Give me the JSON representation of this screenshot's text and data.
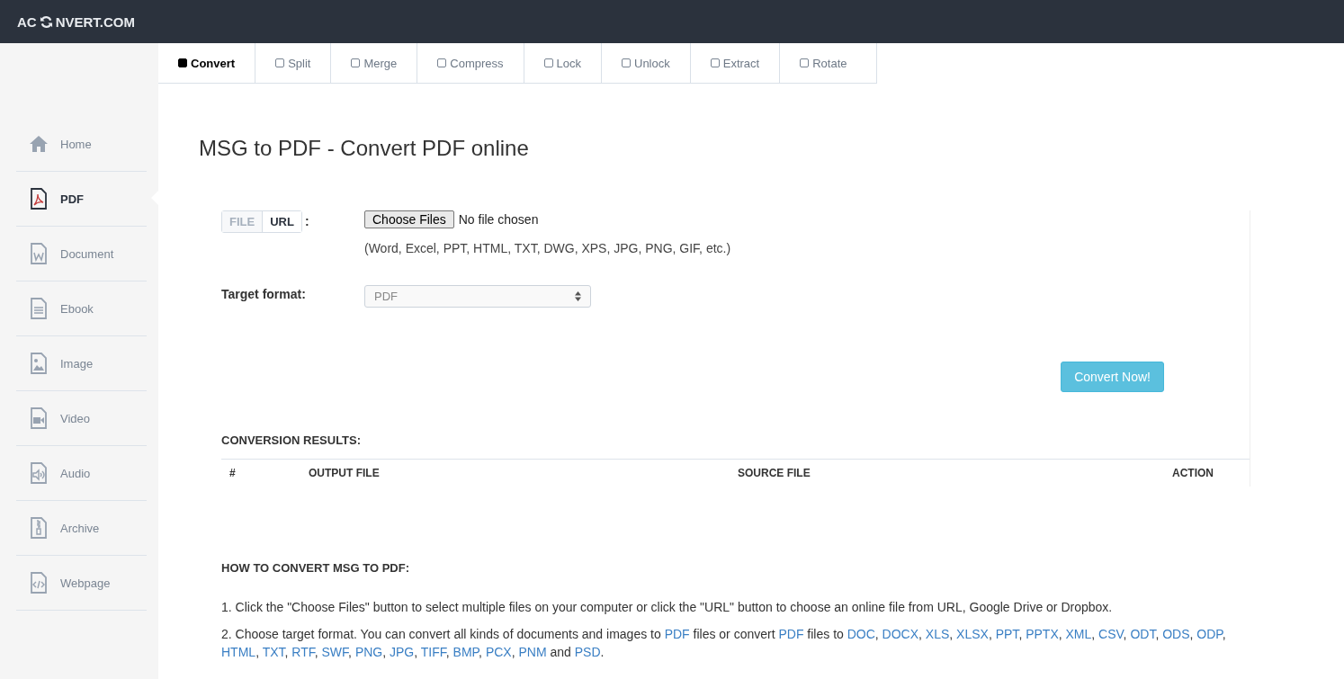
{
  "logo": {
    "before": "AC",
    "after": "NVERT.COM"
  },
  "tabs": [
    {
      "label": "Convert",
      "selected": true
    },
    {
      "label": "Split",
      "selected": false
    },
    {
      "label": "Merge",
      "selected": false
    },
    {
      "label": "Compress",
      "selected": false
    },
    {
      "label": "Lock",
      "selected": false
    },
    {
      "label": "Unlock",
      "selected": false
    },
    {
      "label": "Extract",
      "selected": false
    },
    {
      "label": "Rotate",
      "selected": false
    }
  ],
  "sidebar": {
    "items": [
      {
        "label": "Home",
        "selected": false
      },
      {
        "label": "PDF",
        "selected": true
      },
      {
        "label": "Document",
        "selected": false
      },
      {
        "label": "Ebook",
        "selected": false
      },
      {
        "label": "Image",
        "selected": false
      },
      {
        "label": "Video",
        "selected": false
      },
      {
        "label": "Audio",
        "selected": false
      },
      {
        "label": "Archive",
        "selected": false
      },
      {
        "label": "Webpage",
        "selected": false
      }
    ]
  },
  "title": "MSG to PDF - Convert PDF online",
  "source_toggle": {
    "options": [
      {
        "label": "FILE",
        "selected": false
      },
      {
        "label": "URL",
        "selected": true
      }
    ],
    "colon": ":"
  },
  "file_input": {
    "button": "Choose Files",
    "status": "No file chosen"
  },
  "formats_hint": "(Word, Excel, PPT, HTML, TXT, DWG, XPS, JPG, PNG, GIF, etc.)",
  "target_format": {
    "label": "Target format:",
    "value": "PDF"
  },
  "convert_button": "Convert Now!",
  "results": {
    "title": "CONVERSION RESULTS:",
    "columns": [
      "#",
      "OUTPUT FILE",
      "SOURCE FILE",
      "ACTION"
    ]
  },
  "howto": {
    "title": "HOW TO CONVERT MSG TO PDF:",
    "steps": [
      [
        {
          "text": "1. Click the \"Choose Files\" button to select multiple files on your computer or click the \"URL\" button to choose an online file from URL, Google Drive or Dropbox.",
          "link": false
        }
      ],
      [
        {
          "text": "2. Choose target format. You can convert all kinds of documents and images to ",
          "link": false
        },
        {
          "text": "PDF",
          "link": true
        },
        {
          "text": " files or convert ",
          "link": false
        },
        {
          "text": "PDF",
          "link": true
        },
        {
          "text": " files to ",
          "link": false
        },
        {
          "text": "DOC",
          "link": true
        },
        {
          "text": ", ",
          "link": false
        },
        {
          "text": "DOCX",
          "link": true
        },
        {
          "text": ", ",
          "link": false
        },
        {
          "text": "XLS",
          "link": true
        },
        {
          "text": ", ",
          "link": false
        },
        {
          "text": "XLSX",
          "link": true
        },
        {
          "text": ", ",
          "link": false
        },
        {
          "text": "PPT",
          "link": true
        },
        {
          "text": ", ",
          "link": false
        },
        {
          "text": "PPTX",
          "link": true
        },
        {
          "text": ", ",
          "link": false
        },
        {
          "text": "XML",
          "link": true
        },
        {
          "text": ", ",
          "link": false
        },
        {
          "text": "CSV",
          "link": true
        },
        {
          "text": ", ",
          "link": false
        },
        {
          "text": "ODT",
          "link": true
        },
        {
          "text": ", ",
          "link": false
        },
        {
          "text": "ODS",
          "link": true
        },
        {
          "text": ", ",
          "link": false
        },
        {
          "text": "ODP",
          "link": true
        },
        {
          "text": ", ",
          "link": false
        },
        {
          "text": "HTML",
          "link": true
        },
        {
          "text": ", ",
          "link": false
        },
        {
          "text": "TXT",
          "link": true
        },
        {
          "text": ", ",
          "link": false
        },
        {
          "text": "RTF",
          "link": true
        },
        {
          "text": ", ",
          "link": false
        },
        {
          "text": "SWF",
          "link": true
        },
        {
          "text": ", ",
          "link": false
        },
        {
          "text": "PNG",
          "link": true
        },
        {
          "text": ", ",
          "link": false
        },
        {
          "text": "JPG",
          "link": true
        },
        {
          "text": ", ",
          "link": false
        },
        {
          "text": "TIFF",
          "link": true
        },
        {
          "text": ", ",
          "link": false
        },
        {
          "text": "BMP",
          "link": true
        },
        {
          "text": ", ",
          "link": false
        },
        {
          "text": "PCX",
          "link": true
        },
        {
          "text": ", ",
          "link": false
        },
        {
          "text": "PNM",
          "link": true
        },
        {
          "text": " and ",
          "link": false
        },
        {
          "text": "PSD",
          "link": true
        },
        {
          "text": ".",
          "link": false
        }
      ]
    ]
  }
}
